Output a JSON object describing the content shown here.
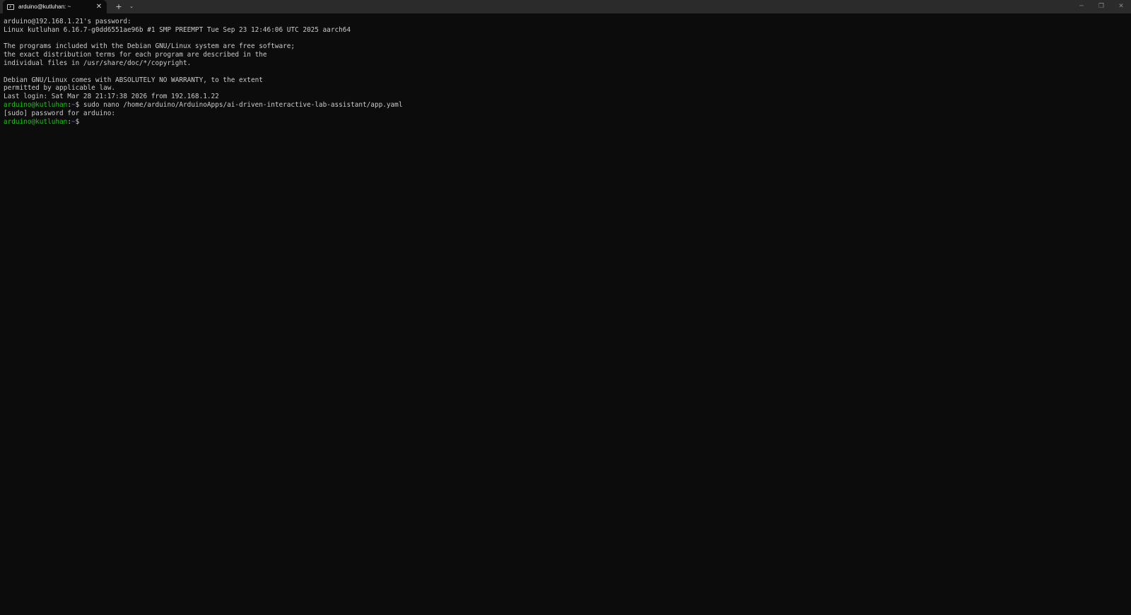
{
  "window": {
    "tab_title": "arduino@kutluhan: ~",
    "tab_close_glyph": "✕",
    "new_tab_glyph": "+",
    "dropdown_glyph": "⌄",
    "minimize_glyph": "─",
    "restore_glyph": "❐",
    "close_glyph": "✕"
  },
  "terminal": {
    "lines": {
      "l0": "arduino@192.168.1.21's password:",
      "l1": "Linux kutluhan 6.16.7-g0dd6551ae96b #1 SMP PREEMPT Tue Sep 23 12:46:06 UTC 2025 aarch64",
      "l2": "",
      "l3": "The programs included with the Debian GNU/Linux system are free software;",
      "l4": "the exact distribution terms for each program are described in the",
      "l5": "individual files in /usr/share/doc/*/copyright.",
      "l6": "",
      "l7": "Debian GNU/Linux comes with ABSOLUTELY NO WARRANTY, to the extent",
      "l8": "permitted by applicable law.",
      "l9": "Last login: Sat Mar 28 21:17:38 2026 from 192.168.1.22",
      "l11": "[sudo] password for arduino:"
    },
    "prompt1": {
      "user": "arduino@kutluhan",
      "colon": ":",
      "path": "~",
      "symbol": "$ ",
      "command": "sudo nano /home/arduino/ArduinoApps/ai-driven-interactive-lab-assistant/app.yaml"
    },
    "prompt2": {
      "user": "arduino@kutluhan",
      "colon": ":",
      "path": "~",
      "symbol": "$ ",
      "command": ""
    },
    "colors": {
      "background": "#0c0c0c",
      "foreground": "#cccccc",
      "prompt_user": "#16c60c",
      "prompt_path": "#3b78ff"
    }
  }
}
